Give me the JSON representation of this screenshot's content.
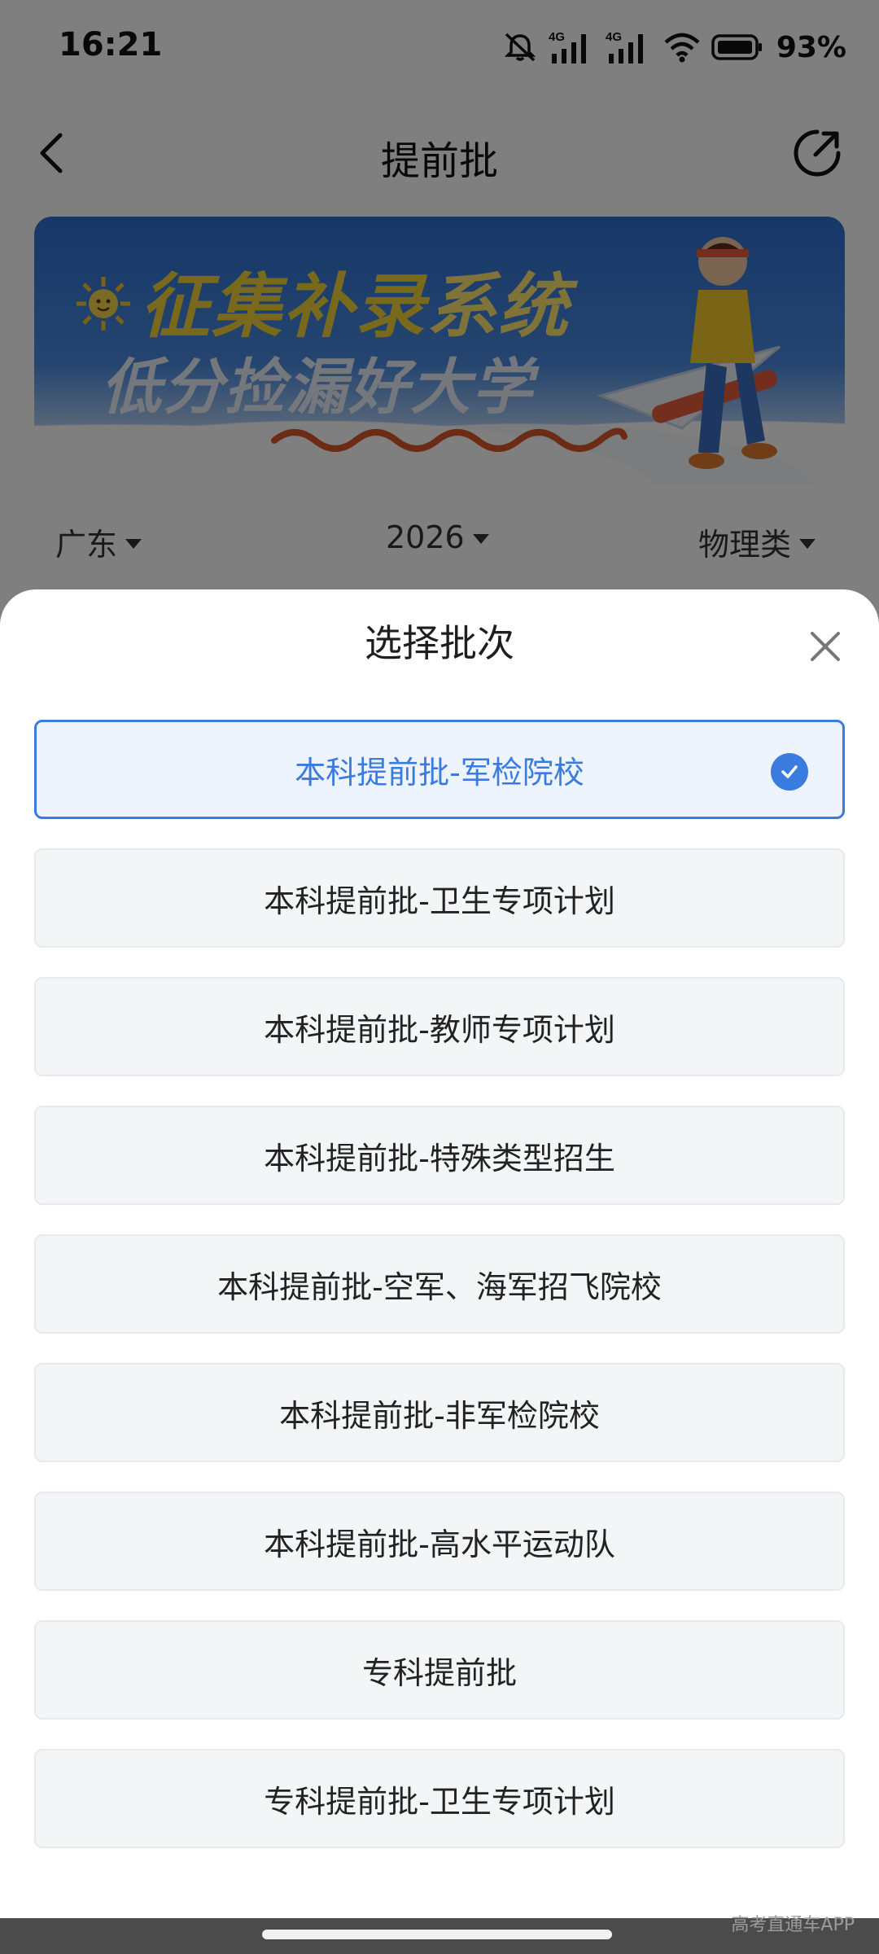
{
  "status_bar": {
    "time": "16:21",
    "battery_percent": "93%",
    "icons": [
      "mute-icon",
      "signal-4g-icon",
      "signal-4g-icon",
      "wifi-icon",
      "battery-icon"
    ]
  },
  "nav": {
    "title": "提前批",
    "back_icon": "chevron-left-icon",
    "share_icon": "share-icon"
  },
  "banner": {
    "line1_highlight": "征集补录",
    "line1_rest": "系统",
    "line2": "低分捡漏好大学"
  },
  "filters": {
    "province": "广东",
    "year": "2026",
    "subject": "物理类"
  },
  "sheet": {
    "title": "选择批次",
    "close_icon": "close-icon",
    "selected_index": 0,
    "options": [
      "本科提前批-军检院校",
      "本科提前批-卫生专项计划",
      "本科提前批-教师专项计划",
      "本科提前批-特殊类型招生",
      "本科提前批-空军、海军招飞院校",
      "本科提前批-非军检院校",
      "本科提前批-高水平运动队",
      "专科提前批",
      "专科提前批-卫生专项计划"
    ]
  },
  "watermark": "高考直通车APP",
  "colors": {
    "accent": "#3a7be0",
    "selected_bg": "#edf4fe",
    "option_bg": "#f4f5f7"
  }
}
